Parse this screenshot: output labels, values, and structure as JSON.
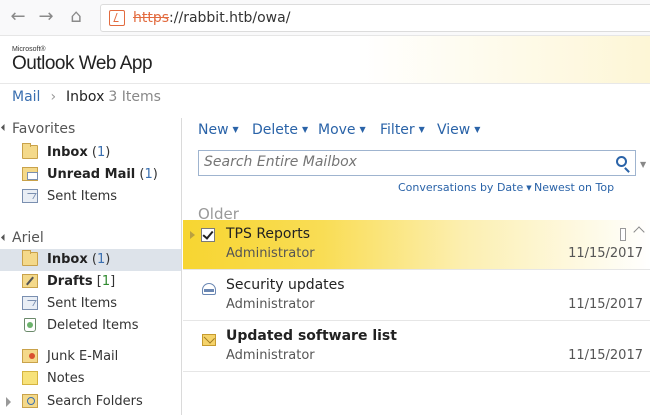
{
  "browser": {
    "url_scheme": "https",
    "url_rest": "://rabbit.htb/owa/",
    "back_icon": "arrow-left-icon",
    "forward_icon": "arrow-right-icon"
  },
  "header": {
    "logo_brand": "Microsoft®",
    "logo_name": "Outlook Web App"
  },
  "breadcrumb": {
    "mail": "Mail",
    "separator": "›",
    "folder": "Inbox",
    "count": "3 Items"
  },
  "sidebar": {
    "favorites_title": "Favorites",
    "favorites": [
      {
        "label": "Inbox",
        "count": "1",
        "icon": "inbox-folder-icon"
      },
      {
        "label": "Unread Mail",
        "count": "1",
        "icon": "unread-mail-icon"
      },
      {
        "label": "Sent Items",
        "count": "",
        "icon": "sent-items-icon"
      }
    ],
    "mailbox_title": "Ariel",
    "folders": [
      {
        "label": "Inbox",
        "count": "1",
        "icon": "inbox-folder-icon"
      },
      {
        "label": "Drafts",
        "count": "1",
        "icon": "drafts-icon"
      },
      {
        "label": "Sent Items",
        "count": "",
        "icon": "sent-items-icon"
      },
      {
        "label": "Deleted Items",
        "count": "",
        "icon": "deleted-items-icon"
      },
      {
        "label": "Junk E-Mail",
        "count": "",
        "icon": "junk-mail-icon"
      },
      {
        "label": "Notes",
        "count": "",
        "icon": "notes-icon"
      },
      {
        "label": "Search Folders",
        "count": "",
        "icon": "search-folders-icon"
      }
    ]
  },
  "toolbar": {
    "new": "New",
    "delete": "Delete",
    "move": "Move",
    "filter": "Filter",
    "view": "View"
  },
  "search": {
    "placeholder": "Search Entire Mailbox"
  },
  "sort": {
    "arrange": "Conversations by Date",
    "order": "Newest on Top"
  },
  "group_header": "Older",
  "messages": [
    {
      "subject": "TPS Reports",
      "sender": "Administrator",
      "date": "11/15/2017",
      "selected": true,
      "unread": false
    },
    {
      "subject": "Security updates",
      "sender": "Administrator",
      "date": "11/15/2017",
      "selected": false,
      "unread": false
    },
    {
      "subject": "Updated software list",
      "sender": "Administrator",
      "date": "11/15/2017",
      "selected": false,
      "unread": true
    }
  ],
  "colors": {
    "link_blue": "#2a63a8",
    "selected_yellow": "#f7d531",
    "sidebar_selected": "#dde3ea"
  }
}
